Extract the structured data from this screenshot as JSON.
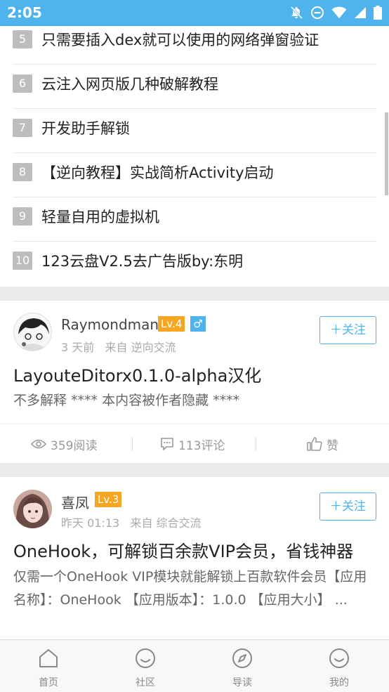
{
  "status_bar": {
    "time": "2:05"
  },
  "ranking_list": [
    {
      "num": "5",
      "title": "只需要插入dex就可以使用的网络弹窗验证"
    },
    {
      "num": "6",
      "title": "云注入网页版几种破解教程"
    },
    {
      "num": "7",
      "title": "开发助手解锁"
    },
    {
      "num": "8",
      "title": "【逆向教程】实战简析Activity启动"
    },
    {
      "num": "9",
      "title": "轻量自用的虚拟机"
    },
    {
      "num": "10",
      "title": "123云盘V2.5去广告版by:东明"
    }
  ],
  "posts": [
    {
      "username": "Raymondman",
      "level": "Lv.4",
      "gender": "♂",
      "time": "3 天前",
      "from": "来自 逆向交流",
      "follow_label": "关注",
      "title": "LayouteDitorx0.1.0-alpha汉化",
      "excerpt": "不多解释 **** 本内容被作者隐藏 ****",
      "reads": "359阅读",
      "comments": "113评论",
      "like_label": "赞"
    },
    {
      "username": "喜凤",
      "level": "Lv.3",
      "time": "昨天 01:13",
      "from": "来自 综合交流",
      "follow_label": "关注",
      "title": "OneHook，可解锁百余款VIP会员，省钱神器",
      "excerpt": "仅需一个OneHook VIP模块就能解锁上百款软件会员【应用名称】：OneHook 【应用版本】：1.0.0 【应用大小】 ..."
    }
  ],
  "bottom_nav": [
    {
      "label": "首页",
      "icon": "home-icon"
    },
    {
      "label": "社区",
      "icon": "community-icon"
    },
    {
      "label": "导读",
      "icon": "compass-icon"
    },
    {
      "label": "我的",
      "icon": "profile-icon"
    }
  ],
  "colors": {
    "accent": "#4fb3ee",
    "level_badge": "#f5a623",
    "rank_badge": "#bdbdbd"
  }
}
